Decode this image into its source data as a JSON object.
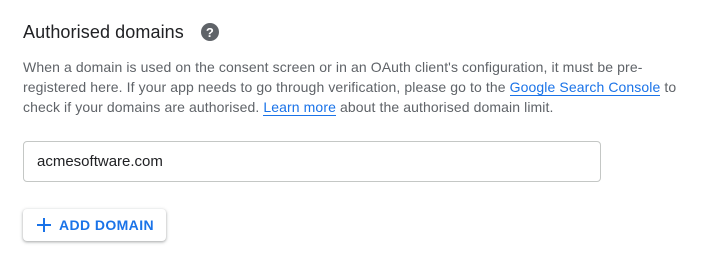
{
  "section": {
    "title": "Authorised domains",
    "help_icon": "help-circle-icon",
    "description": {
      "part1": "When a domain is used on the consent screen or in an OAuth client's configuration, it must be pre-registered here. If your app needs to go through verification, please go to the ",
      "link1": "Google Search Console",
      "part2": " to check if your domains are authorised. ",
      "link2": "Learn more",
      "part3": " about the authorised domain limit."
    },
    "domains": [
      {
        "value": "acmesoftware.com"
      }
    ],
    "add_button": {
      "icon": "plus-icon",
      "label": "ADD DOMAIN"
    }
  },
  "colors": {
    "text_primary": "#202124",
    "text_secondary": "#5f6368",
    "accent": "#1a73e8",
    "border": "#c4c7c5"
  }
}
